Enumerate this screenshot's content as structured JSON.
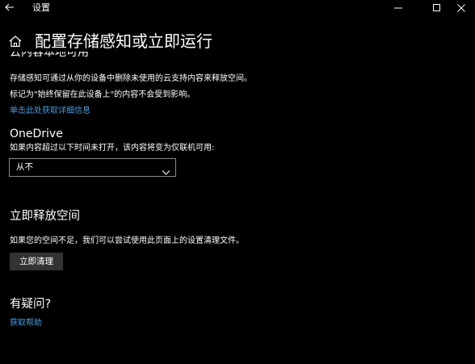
{
  "window": {
    "title": "设置"
  },
  "header": {
    "page_title": "配置存储感知或立即运行"
  },
  "cloud_section": {
    "clipped_heading": "云内容本地可用",
    "description_line1": "存储感知可通过从你的设备中删除未使用的云支持内容来释放空间。",
    "description_line2": "标记为\"始终保留在此设备上\"的内容不会受到影响。",
    "details_link": "单击此处获取详细信息"
  },
  "onedrive": {
    "title": "OneDrive",
    "description": "如果内容超过以下时间未打开，该内容将变为仅联机可用:",
    "selected_value": "从不"
  },
  "free_space": {
    "title": "立即释放空间",
    "description": "如果您的空间不足，我们可以尝试使用此页面上的设置清理文件。",
    "button_label": "立即清理"
  },
  "help": {
    "title": "有疑问?",
    "link": "获取帮助"
  }
}
